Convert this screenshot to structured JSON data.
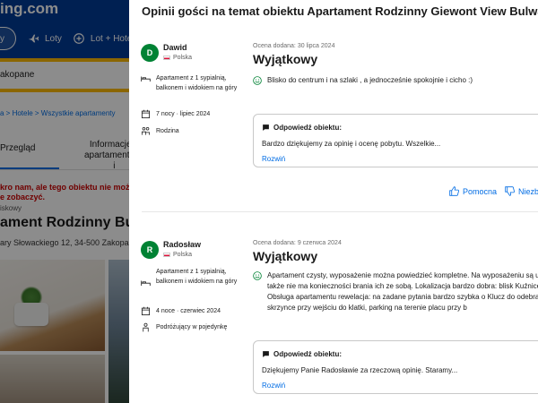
{
  "background": {
    "logo": "ing.com",
    "nav": [
      "Loty",
      "Lot + Hotel"
    ],
    "search_value": "akopane",
    "breadcrumb": "a > Hotele > Wszystkie apartamenty",
    "tab_overview": "Przegląd",
    "tab_info_line1": "Informacje o",
    "tab_info_line2": "apartamentach i",
    "alert_line1": "kro nam, ale tego obiektu nie można",
    "alert_line2": "e zobaczyć.",
    "type": "iskowy",
    "title": "ament Rodzinny Bulwa",
    "address": "ary Słowackiego 12, 34-500 Zakopane, P"
  },
  "panel": {
    "title": "Opinii gości na temat obiektu Apartament Rodzinny Giewont View Bulwary"
  },
  "reviews": [
    {
      "initial": "D",
      "name": "Dawid",
      "country": "Polska",
      "room": "Apartament z 1 sypialnią, balkonem i widokiem na góry",
      "stay": "7 nocy · lipiec 2024",
      "traveler": "Rodzina",
      "date": "Ocena dodana: 30 lipca 2024",
      "title": "Wyjątkowy",
      "text": "Blisko do centrum i na szlaki , a jednocześnie spokojnie i cicho :)",
      "reply_label": "Odpowiedź obiektu:",
      "reply_text": "Bardzo dziękujemy za opinię i ocenę pobytu. Wszelkie...",
      "reply_more": "Rozwiń",
      "helpful": "Pomocna",
      "not_helpful": "Niezby"
    },
    {
      "initial": "R",
      "name": "Radosław",
      "country": "Polska",
      "room": "Apartament z 1 sypialnią, balkonem i widokiem na góry",
      "stay": "4 noce · czerwiec 2024",
      "traveler": "Podróżujący w pojedynkę",
      "date": "Ocena dodana: 9 czerwca 2024",
      "title": "Wyjątkowy",
      "text": "Apartament czysty, wyposażenie można powiedzieć kompletne. Na wyposażeniu są u ręczniki także nie ma konieczności brania ich ze sobą. Lokalizacja bardzo dobra: blisk Kuźnice, sklepy. Obsługa apartamentu rewelacja: na zadane pytania bardzo szybka o Klucz do odebrania w skrzynce przy wejściu do klatki, parking na terenie placu przy b",
      "reply_label": "Odpowiedź obiektu:",
      "reply_text": "Dziękujemy Panie Radosławie za rzeczową opinię. Staramy...",
      "reply_more": "Rozwiń"
    }
  ],
  "colors": {
    "brand_blue": "#003b95",
    "link_blue": "#006ce4",
    "avatar_green": "#008234",
    "yellow": "#febb02"
  }
}
